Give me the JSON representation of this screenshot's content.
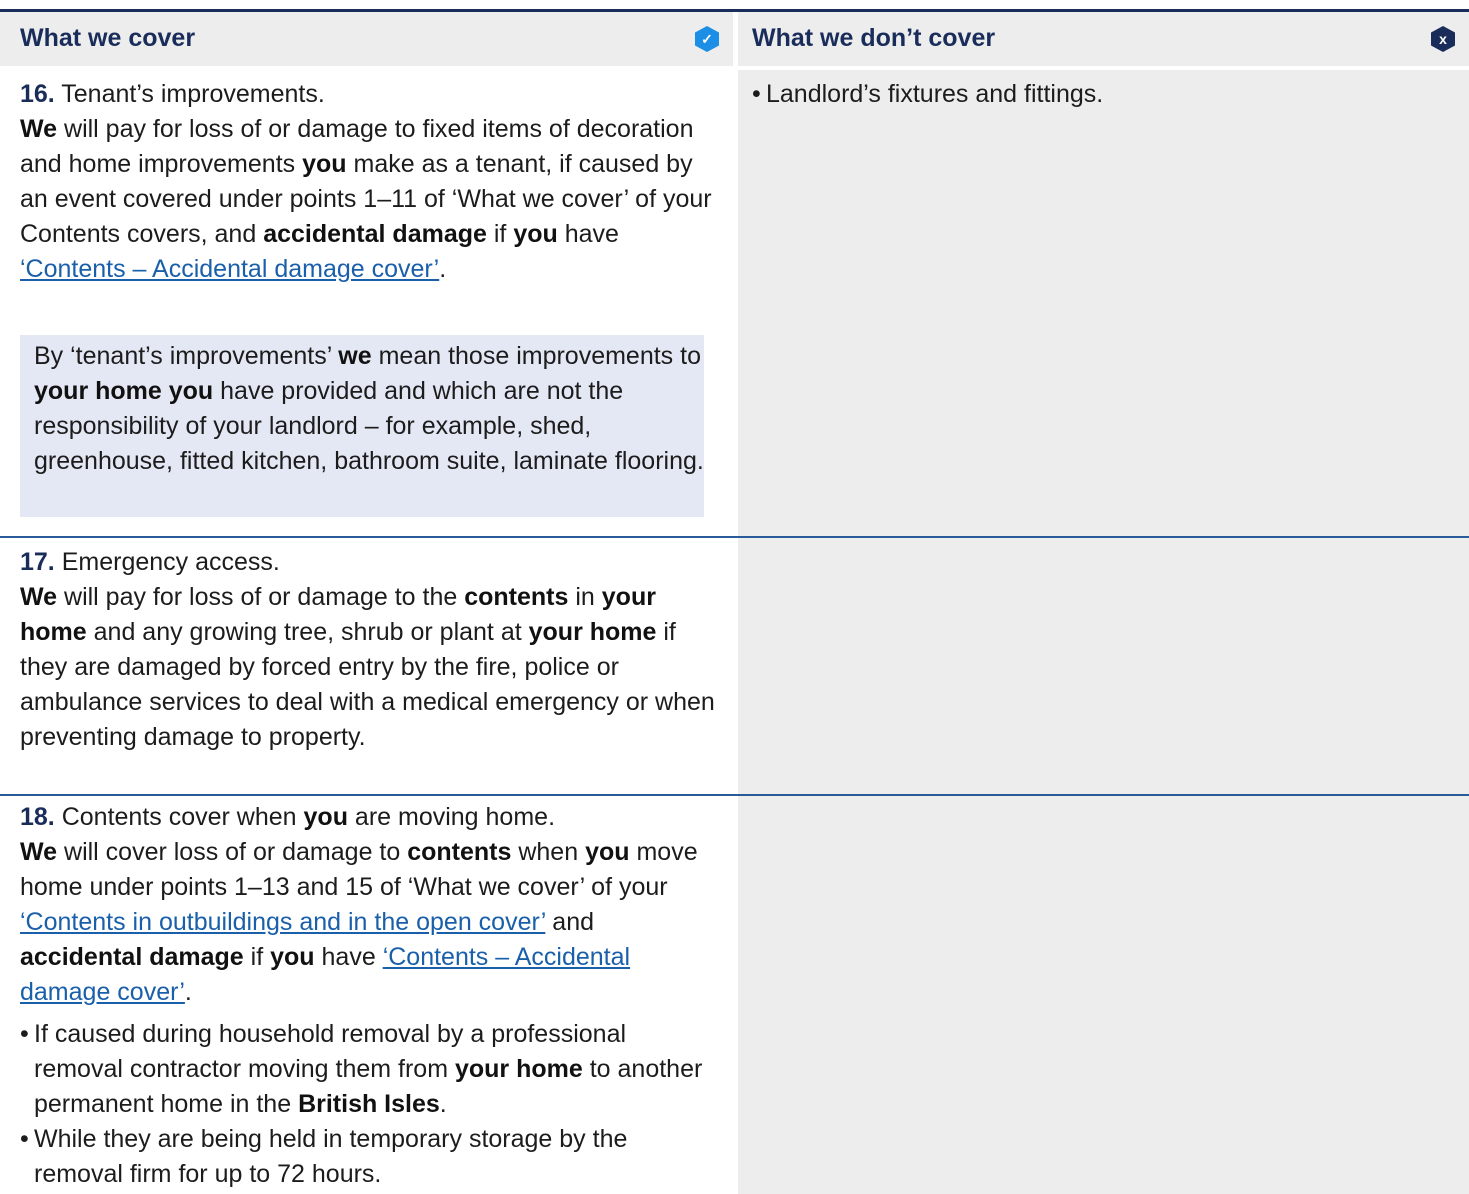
{
  "header": {
    "cover_title": "What we cover",
    "not_cover_title": "What we don’t cover",
    "check_badge": "✓",
    "x_badge": "x"
  },
  "rows": [
    {
      "number": "16.",
      "title": "Tenant’s improvements.",
      "body": {
        "p1": "We",
        "p2": " will pay for loss of or damage to fixed items of decoration and home improvements ",
        "p3": "you",
        "p4": " make as a tenant, if caused by an event covered under points 1–11 of ‘What we cover’ of your Contents covers, and ",
        "p5": "accidental damage",
        "p6": " if ",
        "p7": "you",
        "p8": " have ",
        "link": "‘Contents – Accidental damage cover’",
        "p9": "."
      },
      "note": {
        "n1": "By ‘tenant’s improvements’ ",
        "n2": "we",
        "n3": " mean those improvements to ",
        "n4": "your home you",
        "n5": " have provided and which are not the responsibility of your landlord – for example, shed, greenhouse, fitted kitchen, bathroom suite, laminate flooring."
      },
      "not_covered": "Landlord’s fixtures and fittings."
    },
    {
      "number": "17.",
      "title": "Emergency access.",
      "body": {
        "p1": "We",
        "p2": " will pay for loss of or damage to the ",
        "p3": "contents",
        "p4": " in ",
        "p5": "your home",
        "p6": " and any growing tree, shrub or plant at ",
        "p7": "your home",
        "p8": " if they are damaged by forced entry by the fire, police or ambulance services to deal with a medical emergency or when preventing damage to property."
      }
    },
    {
      "number": "18.",
      "title_a": "Contents cover when ",
      "title_b": "you",
      "title_c": " are moving home.",
      "body": {
        "p1": "We",
        "p2": " will cover loss of or damage to ",
        "p3": "contents",
        "p4": " when ",
        "p5": "you",
        "p6": " move home under points 1–13 and 15 of ‘What we cover’ of your ",
        "link1": "‘Contents in outbuildings and in the open cover’",
        "p7": " and ",
        "p8": "accidental damage",
        "p9": " if ",
        "p10": "you",
        "p11": " have ",
        "link2": "‘Contents – Accidental damage cover’",
        "p12": "."
      },
      "bullets": {
        "b1a": "If caused during household removal by a professional removal contractor moving them from ",
        "b1b": "your home",
        "b1c": " to another permanent home in the ",
        "b1d": "British Isles",
        "b1e": ".",
        "b2": "While they are being held in temporary storage by the removal firm for up to 72 hours."
      }
    }
  ]
}
